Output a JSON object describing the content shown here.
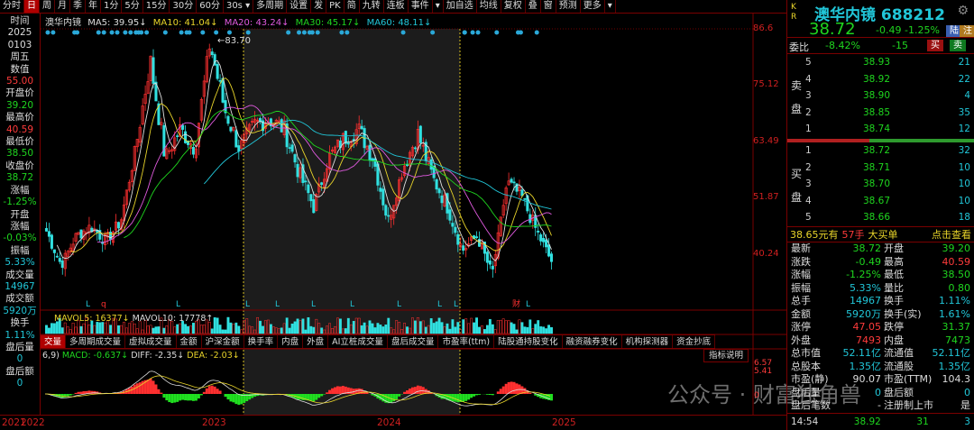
{
  "toolbar": {
    "items": [
      "分时",
      "日",
      "周",
      "月",
      "季",
      "年",
      "1分",
      "5分",
      "15分",
      "30分",
      "60分",
      "30s ▾",
      "多周期",
      "设置",
      "发",
      "PK",
      "简",
      "九转",
      "连板",
      "事件",
      "▾",
      "加自选",
      "均线",
      "复权",
      "叠",
      "窗",
      "预测",
      "更多",
      "▾"
    ],
    "active": 1
  },
  "sidebar": [
    [
      "时间",
      "white"
    ],
    [
      "2025",
      "white"
    ],
    [
      "0103",
      "white"
    ],
    [
      "周五",
      "white"
    ],
    [
      "数值",
      "white"
    ],
    [
      "55.00",
      "red"
    ],
    [
      "开盘价",
      "white"
    ],
    [
      "39.20",
      "green"
    ],
    [
      "最高价",
      "white"
    ],
    [
      "40.59",
      "red"
    ],
    [
      "最低价",
      "white"
    ],
    [
      "38.50",
      "green"
    ],
    [
      "收盘价",
      "white"
    ],
    [
      "38.72",
      "green"
    ],
    [
      "涨幅",
      "white"
    ],
    [
      "-1.25%",
      "green"
    ],
    [
      "开盘",
      "white"
    ],
    [
      "涨幅",
      "white"
    ],
    [
      "-0.03%",
      "green"
    ],
    [
      "振幅",
      "white"
    ],
    [
      "5.33%",
      "cyan"
    ],
    [
      "成交量",
      "white"
    ],
    [
      "14967",
      "cyan"
    ],
    [
      "成交额",
      "white"
    ],
    [
      "5920万",
      "cyan"
    ],
    [
      "换手",
      "white"
    ],
    [
      "1.11%",
      "cyan"
    ],
    [
      "盘后量",
      "white"
    ],
    [
      "0",
      "cyan"
    ],
    [
      "盘后额",
      "white"
    ],
    [
      "0",
      "cyan"
    ]
  ],
  "ma_legend": {
    "name": "澳华内镜",
    "ma5": "MA5: 39.95↓",
    "ma10": "MA10: 41.04↓",
    "ma20": "MA20: 43.24↓",
    "ma30": "MA30: 45.17↓",
    "ma60": "MA60: 48.11↓"
  },
  "high_marker": "83.70",
  "vol_legend": {
    "mavol5": "MAVOL5: 16377↓",
    "mavol10": "MAVOL10: 17778↑"
  },
  "tabs": [
    "交量",
    "多周期成交量",
    "虚拟成交量",
    "金额",
    "沪深金额",
    "换手率",
    "内盘",
    "外盘",
    "AI立桩成交量",
    "盘后成交量",
    "市盈率(ttm)",
    "陆股通持股变化",
    "融资融券变化",
    "机构探测器",
    "资金抄底"
  ],
  "macd_legend": {
    "params": "6,9)",
    "macd": "MACD: -0.637↓",
    "diff": "DIFF: -2.35↓",
    "dea": "DEA: -2.03↓"
  },
  "indicator_help": "指标说明",
  "macd_axis": [
    "6.57",
    "5.41",
    "0"
  ],
  "years": [
    "2021",
    "2022",
    "2023",
    "2024",
    "2025"
  ],
  "chart_data": {
    "type": "candlestick",
    "title": "澳华内镜 日线",
    "y_ticks": [
      86.6,
      75.12,
      63.49,
      51.87,
      40.24
    ],
    "ylim": [
      32,
      86.6
    ],
    "approx_close_trend": [
      45,
      38,
      44,
      46,
      43,
      47,
      62,
      80,
      60,
      66,
      62,
      83.7,
      70,
      62,
      67,
      68,
      66,
      57,
      50,
      60,
      64,
      66,
      60,
      47,
      58,
      65,
      56,
      50,
      41,
      44,
      36,
      55,
      52,
      45,
      38.72
    ],
    "max_label": "83.70",
    "markers": [
      "L",
      "q",
      "L",
      "L",
      "L",
      "L",
      "L",
      "L",
      "L",
      "L",
      "财",
      "L"
    ]
  },
  "quote": {
    "kr": "K R",
    "name": "澳华内镜",
    "code": "688212",
    "price": "38.72",
    "change": "-0.49",
    "pct": "-1.25%",
    "tag1": "陆",
    "tag2": "注",
    "wb_label": "委比",
    "wb": "-8.42%",
    "wc": "-15",
    "buy": "买",
    "sell": "卖"
  },
  "orderbook": {
    "sell_label": [
      "卖",
      "盘"
    ],
    "buy_label": [
      "买",
      "盘"
    ],
    "sell": [
      [
        "5",
        "38.93",
        "21"
      ],
      [
        "4",
        "38.92",
        "22"
      ],
      [
        "3",
        "38.90",
        "4"
      ],
      [
        "2",
        "38.85",
        "35"
      ],
      [
        "1",
        "38.74",
        "12"
      ]
    ],
    "buy": [
      [
        "1",
        "38.72",
        "32"
      ],
      [
        "2",
        "38.71",
        "10"
      ],
      [
        "3",
        "38.70",
        "10"
      ],
      [
        "4",
        "38.67",
        "10"
      ],
      [
        "5",
        "38.66",
        "18"
      ]
    ]
  },
  "bigorder": {
    "price": "38.65元有",
    "qty": "57手",
    "label": "大买单",
    "link": "点击查看"
  },
  "stats": [
    [
      "最新",
      "38.72",
      "green",
      "开盘",
      "39.20",
      "green"
    ],
    [
      "涨跌",
      "-0.49",
      "green",
      "最高",
      "40.59",
      "red"
    ],
    [
      "涨幅",
      "-1.25%",
      "green",
      "最低",
      "38.50",
      "green"
    ],
    [
      "振幅",
      "5.33%",
      "cyan",
      "量比",
      "0.80",
      "green"
    ],
    [
      "总手",
      "14967",
      "cyan",
      "换手",
      "1.11%",
      "cyan"
    ],
    [
      "金额",
      "5920万",
      "cyan",
      "换手(实)",
      "1.61%",
      "cyan"
    ],
    [
      "涨停",
      "47.05",
      "red",
      "跌停",
      "31.37",
      "green"
    ],
    [
      "外盘",
      "7493",
      "red",
      "内盘",
      "7473",
      "green"
    ],
    [
      "总市值",
      "52.11亿",
      "cyan",
      "流通值",
      "52.11亿",
      "cyan"
    ],
    [
      "总股本",
      "1.35亿",
      "cyan",
      "流通股",
      "1.35亿",
      "cyan"
    ],
    [
      "市盈(静)",
      "90.07",
      "white",
      "市盈(TTM)",
      "104.3",
      "white"
    ],
    [
      "盘后量",
      "0",
      "cyan",
      "盘后额",
      "0",
      "cyan"
    ],
    [
      "盘后笔数",
      "-",
      "white",
      "注册制上市",
      "是",
      "white"
    ]
  ],
  "tick": {
    "time": "14:54",
    "price": "38.92",
    "vol": "31",
    "n": "3"
  },
  "watermark": "公众号 · 财富独角兽"
}
